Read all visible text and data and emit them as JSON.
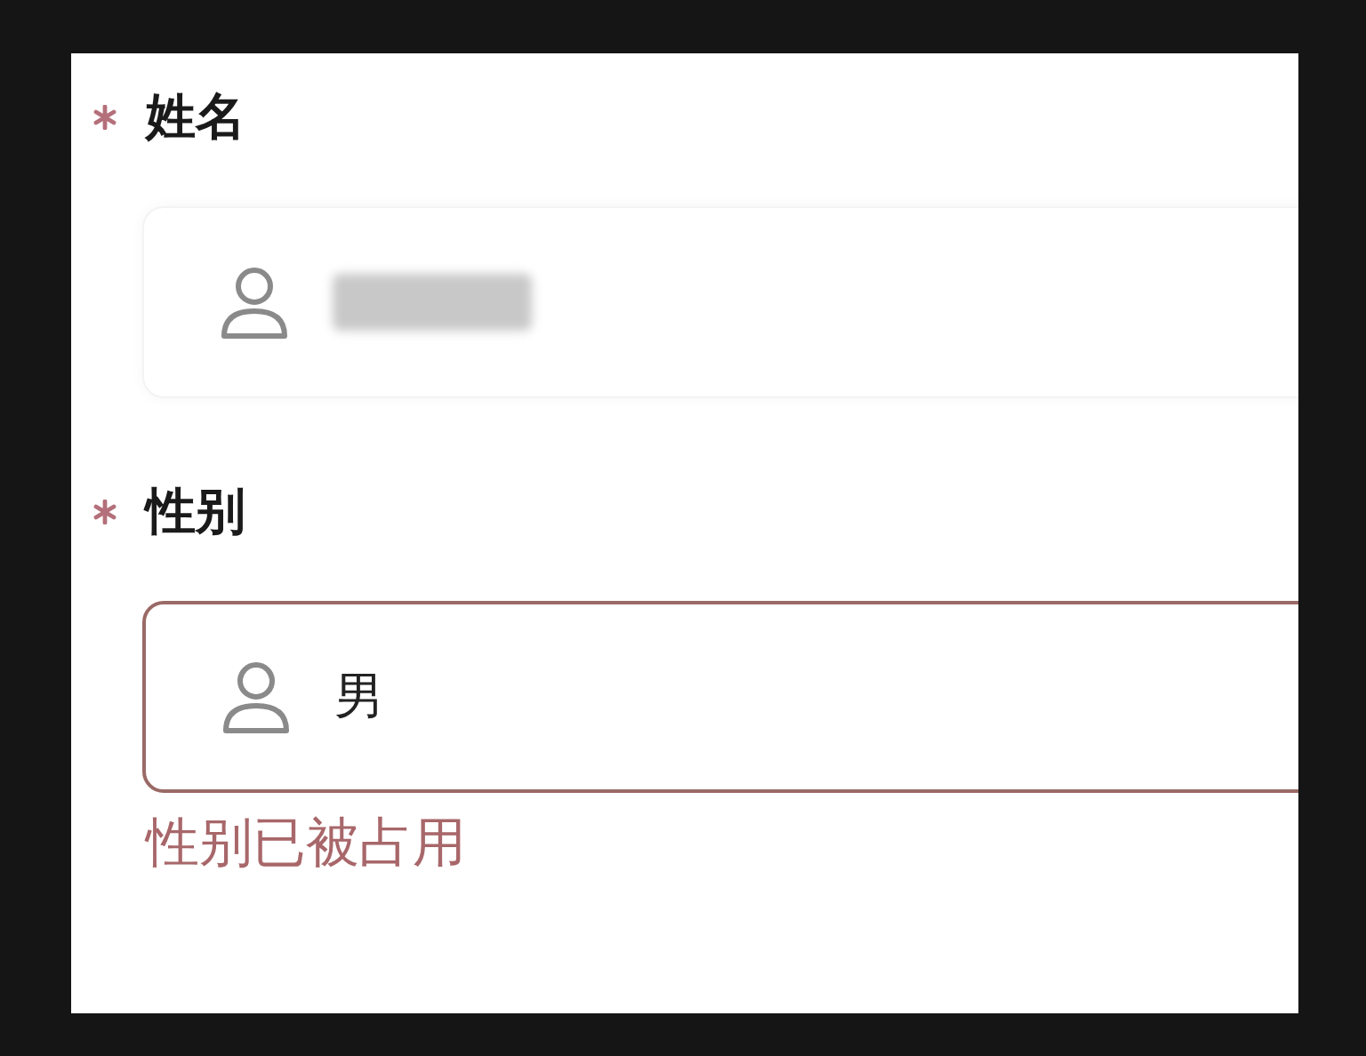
{
  "fields": [
    {
      "label": "姓名",
      "required": true,
      "value_redacted": true,
      "error": false
    },
    {
      "label": "性别",
      "required": true,
      "value": "男",
      "error": true,
      "error_message": "性别已被占用"
    }
  ]
}
